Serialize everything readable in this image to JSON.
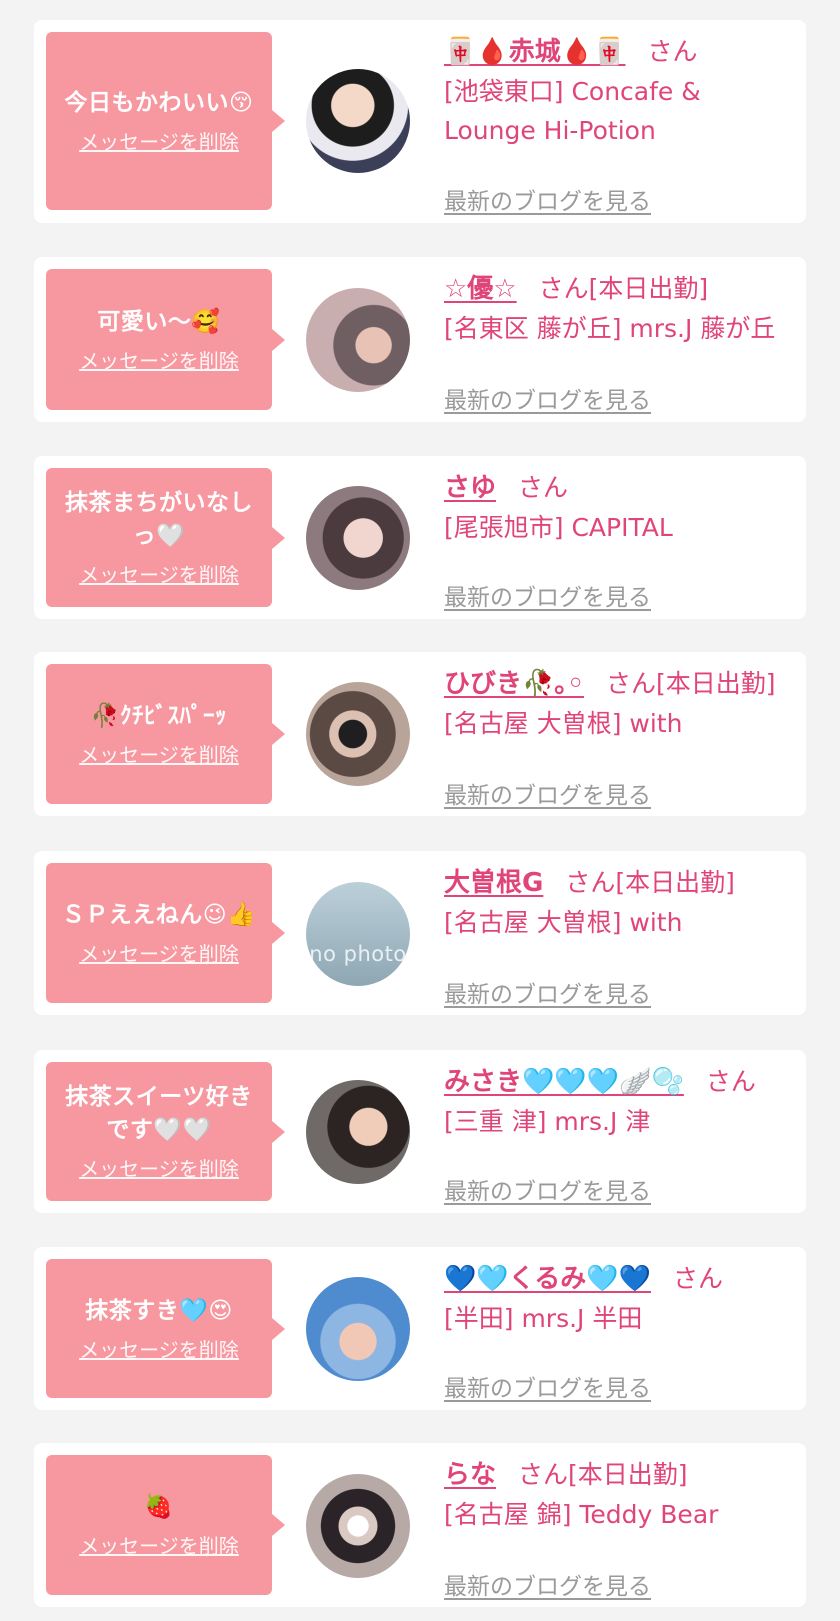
{
  "cards": [
    {
      "message": "今日もかわいい😚",
      "delete_label": "メッセージを削除",
      "name": "🀄️🩸赤城🩸🀄️",
      "honorific": "さん",
      "status": "",
      "shop": "[池袋東口] Concafe & Lounge Hi-Potion",
      "blog_link": "最新のブログを見る",
      "avatar_text": ""
    },
    {
      "message": "可愛い〜🥰",
      "delete_label": "メッセージを削除",
      "name": "☆優☆",
      "honorific": "さん",
      "status": "[本日出勤]",
      "shop": "[名東区 藤が丘] mrs.J 藤が丘",
      "blog_link": "最新のブログを見る",
      "avatar_text": ""
    },
    {
      "message": "抹茶まちがいなしっ🤍",
      "delete_label": "メッセージを削除",
      "name": "さゆ",
      "honorific": "さん",
      "status": "",
      "shop": "[尾張旭市] CAPITAL",
      "blog_link": "最新のブログを見る",
      "avatar_text": ""
    },
    {
      "message": "🥀ｸﾁﾋﾞｽﾊﾟｰｯ",
      "delete_label": "メッセージを削除",
      "name": "ひびき🥀｡◦",
      "honorific": "さん",
      "status": "[本日出勤]",
      "shop": "[名古屋 大曽根] with",
      "blog_link": "最新のブログを見る",
      "avatar_text": ""
    },
    {
      "message": "ＳＰええねん😉👍",
      "delete_label": "メッセージを削除",
      "name": "大曽根G",
      "honorific": "さん",
      "status": "[本日出勤]",
      "shop": "[名古屋 大曽根] with",
      "blog_link": "最新のブログを見る",
      "avatar_text": "no photo"
    },
    {
      "message": "抹茶スイーツ好きです🤍🤍",
      "delete_label": "メッセージを削除",
      "name": "みさき🩵🩵🩵🪽🫧",
      "honorific": "さん",
      "status": "",
      "shop": "[三重 津] mrs.J 津",
      "blog_link": "最新のブログを見る",
      "avatar_text": ""
    },
    {
      "message": "抹茶すき🩵😍",
      "delete_label": "メッセージを削除",
      "name": "💙🩵くるみ🩵💙",
      "honorific": "さん",
      "status": "",
      "shop": "[半田] mrs.J 半田",
      "blog_link": "最新のブログを見る",
      "avatar_text": ""
    },
    {
      "message": "🍓",
      "delete_label": "メッセージを削除",
      "name": "らな",
      "honorific": "さん",
      "status": "[本日出勤]",
      "shop": "[名古屋 錦] Teddy Bear",
      "blog_link": "最新のブログを見る",
      "avatar_text": ""
    }
  ],
  "colors": {
    "background": "#f3f3f3",
    "card": "#ffffff",
    "bubble": "#f7979f",
    "accent": "#e0457a",
    "link_gray": "#9a9a9a"
  }
}
